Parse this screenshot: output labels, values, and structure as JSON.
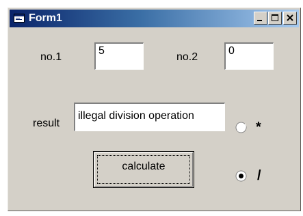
{
  "window": {
    "title": "Form1"
  },
  "form": {
    "no1_label": "no.1",
    "no1_value": "5",
    "no2_label": "no.2",
    "no2_value": "0",
    "result_label": "result",
    "result_value": "illegal division operation",
    "calculate_label": "calculate",
    "radio_multiply": {
      "label": "*",
      "selected": false
    },
    "radio_divide": {
      "label": "/",
      "selected": true
    }
  }
}
